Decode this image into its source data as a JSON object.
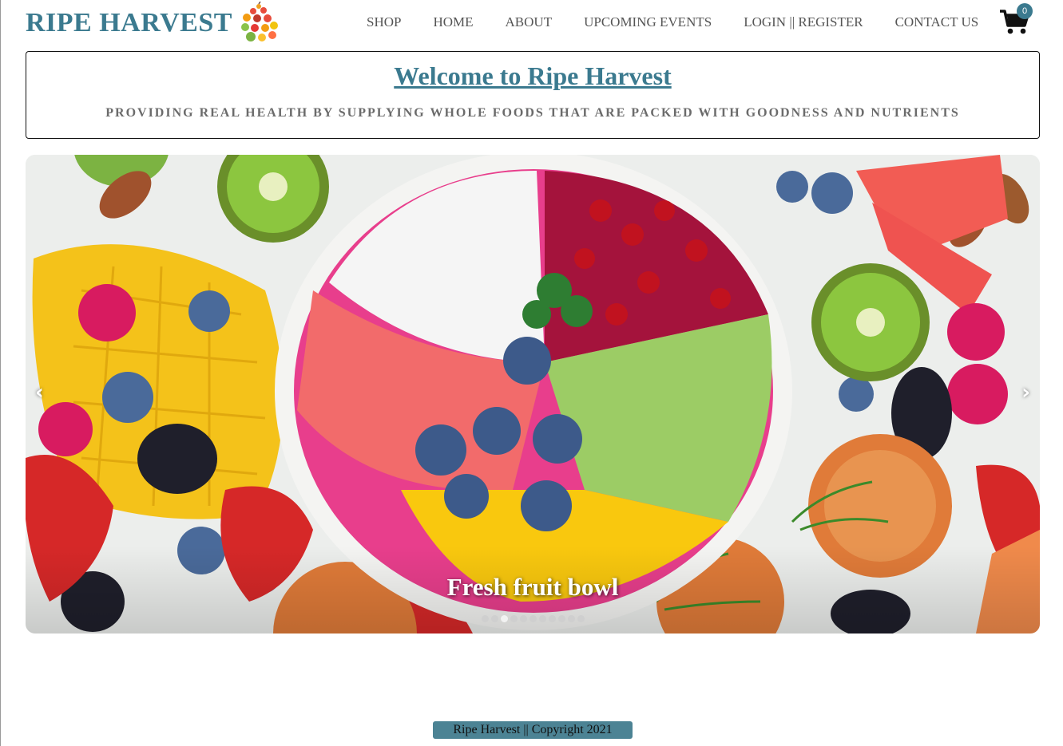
{
  "brand": {
    "name": "RIPE HARVEST",
    "color": "#3b7a8f"
  },
  "nav": {
    "items": [
      {
        "label": "SHOP"
      },
      {
        "label": "HOME"
      },
      {
        "label": "ABOUT"
      },
      {
        "label": "UPCOMING EVENTS"
      },
      {
        "label": "LOGIN || REGISTER"
      },
      {
        "label": "CONTACT US"
      }
    ]
  },
  "cart": {
    "icon": "shopping-cart-icon",
    "count": "0"
  },
  "welcome": {
    "title": "Welcome to Ripe Harvest",
    "subtitle": "PROVIDING REAL HEALTH BY SUPPLYING WHOLE FOODS THAT ARE PACKED WITH GOODNESS AND NUTRIENTS"
  },
  "slideshow": {
    "caption": "Fresh fruit bowl",
    "prev_label": "‹",
    "next_label": "›",
    "slide_count": 11,
    "active_index": 2
  },
  "footer": {
    "text": "Ripe Harvest || Copyright 2021"
  }
}
